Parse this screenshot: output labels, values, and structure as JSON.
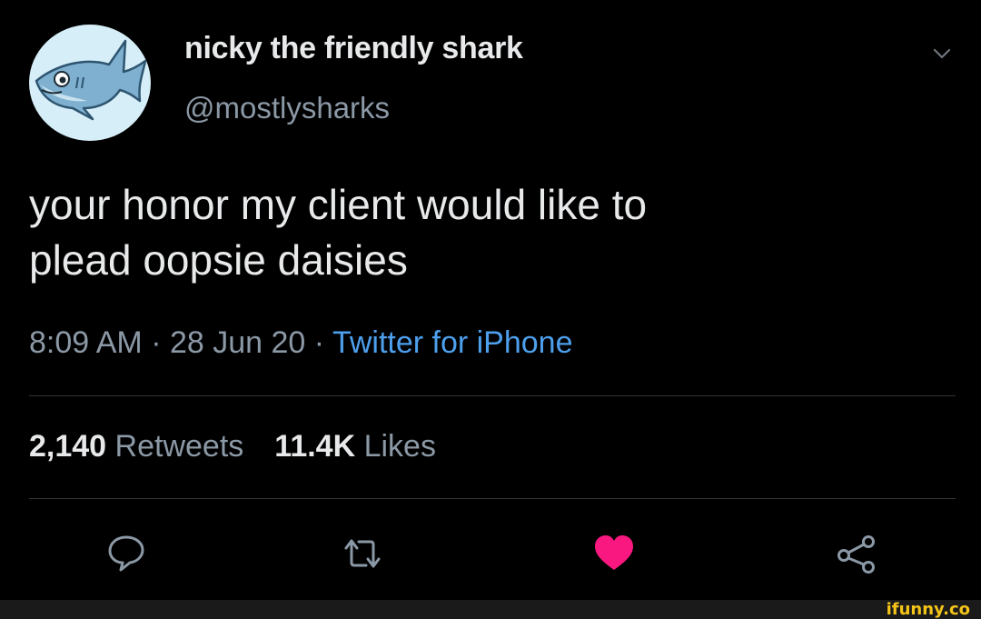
{
  "tweet": {
    "display_name": "nicky the friendly shark",
    "handle": "@mostlysharks",
    "avatar_icon": "shark-icon",
    "text": "your honor my client would like to\nplead oopsie daisies",
    "time": "8:09 AM",
    "separator": " · ",
    "date": "28 Jun 20",
    "source": "Twitter for iPhone",
    "retweets_count": "2,140",
    "retweets_label": "Retweets",
    "likes_count": "11.4K",
    "likes_label": "Likes",
    "liked": true
  },
  "actions": {
    "reply_icon": "reply-icon",
    "retweet_icon": "retweet-icon",
    "like_icon": "heart-icon",
    "share_icon": "share-icon",
    "more_icon": "chevron-down-icon"
  },
  "colors": {
    "background": "#000000",
    "text_primary": "#e7e9ea",
    "text_secondary": "#8b98a5",
    "link": "#4d9fec",
    "like": "#f91880",
    "divider": "#2f3336",
    "watermark": "#f5c418"
  },
  "watermark": {
    "text": "ifunny.co"
  }
}
